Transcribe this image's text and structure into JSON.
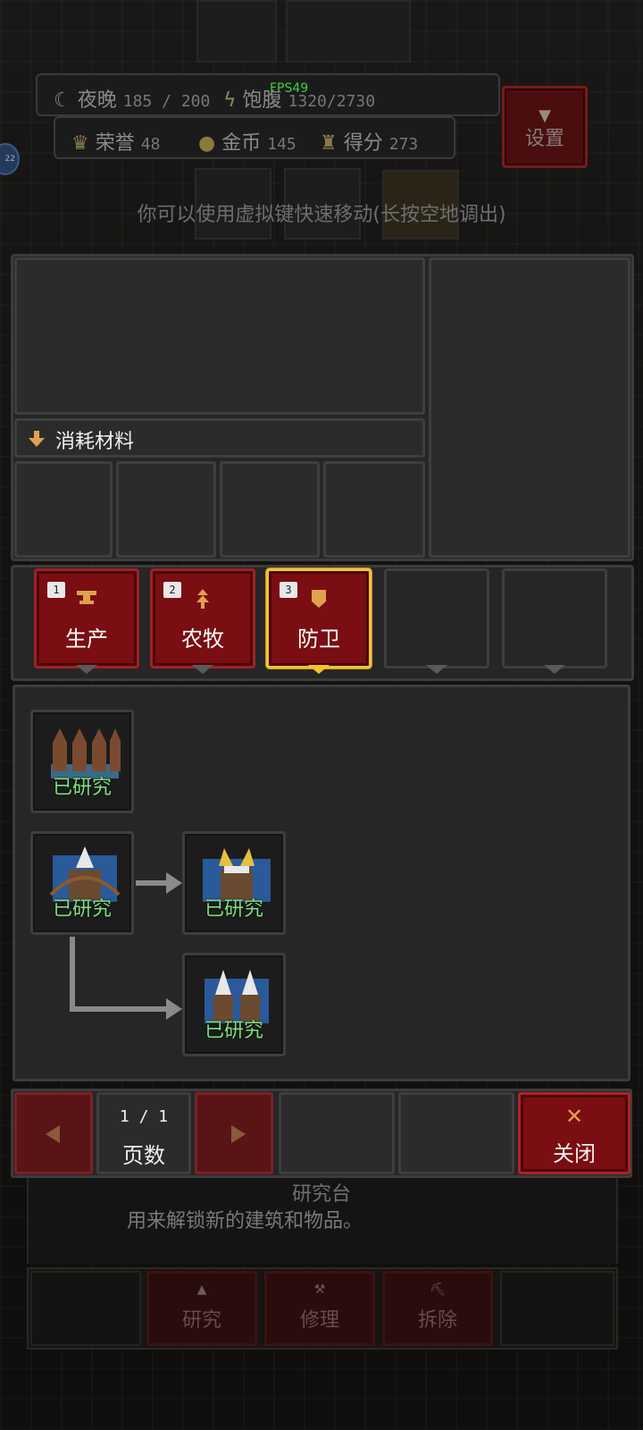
{
  "fps": "FPS49",
  "hud": {
    "night_label": "夜晚",
    "night_value": "185 / 200",
    "satiety_label": "饱腹",
    "satiety_value": "1320/2730",
    "honor_label": "荣誉",
    "honor_value": "48",
    "gold_label": "金币",
    "gold_value": "145",
    "score_label": "得分",
    "score_value": "273",
    "settings_label": "设置"
  },
  "hint": "你可以使用虚拟键快速移动(长按空地调出)",
  "material_label": "消耗材料",
  "tabs": [
    {
      "num": "1",
      "label": "生产",
      "icon": "anvil-icon"
    },
    {
      "num": "2",
      "label": "农牧",
      "icon": "sprout-icon"
    },
    {
      "num": "3",
      "label": "防卫",
      "icon": "shield-icon"
    }
  ],
  "tree": {
    "nodes": [
      {
        "status": "已研究",
        "icon": "spike-barricade-icon"
      },
      {
        "status": "已研究",
        "icon": "crossbow-turret-icon"
      },
      {
        "status": "已研究",
        "icon": "gold-crossbow-turret-icon"
      },
      {
        "status": "已研究",
        "icon": "twin-spike-turret-icon"
      }
    ]
  },
  "pagination": {
    "page_text": "1 / 1",
    "page_label": "页数"
  },
  "close_label": "关闭",
  "info": {
    "title": "研究台",
    "description": "用来解锁新的建筑和物品。"
  },
  "actions": {
    "research": "研究",
    "repair": "修理",
    "demolish": "拆除"
  },
  "colors": {
    "accent_red": "#7a0e12",
    "active_gold": "#f2c230",
    "researched_green": "#7fe07f",
    "fps_green": "#3cd23c"
  }
}
